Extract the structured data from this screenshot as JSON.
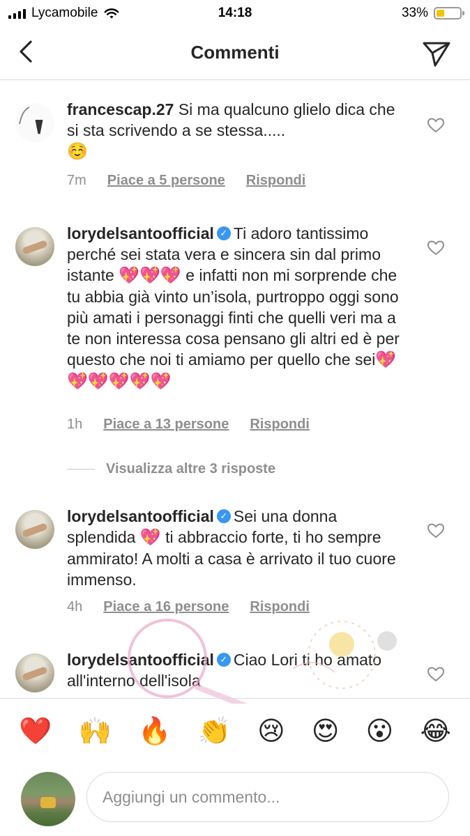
{
  "status_bar": {
    "carrier": "Lycamobile",
    "time": "14:18",
    "battery": "33%",
    "battery_level": 0.33
  },
  "header": {
    "title": "Commenti"
  },
  "comments": [
    {
      "username": "francescap.27",
      "text": "Si ma qualcuno glielo dica che si sta scrivendo a se stessa.....",
      "emoji": "☺️",
      "time": "7m",
      "likes": "Piace a 5 persone",
      "reply": "Rispondi"
    },
    {
      "username": "lorydelsantoofficial",
      "text_part1": "Ti adoro tantissimo perché sei stata vera e sincera sin dal primo istante",
      "emoji1": "💖💖💖",
      "text_part2": "e infatti non mi sorprende che tu abbia già vinto un’isola, purtroppo oggi sono più amati i personaggi finti che quelli veri ma a te non interessa cosa pensano gli altri ed è per questo che noi ti amiamo per quello che sei",
      "emoji2": "💖💖💖💖💖💖",
      "time": "1h",
      "likes": "Piace a 13 persone",
      "reply": "Rispondi"
    },
    {
      "username": "lorydelsantoofficial",
      "text_part1": "Sei una donna splendida",
      "emoji1": "💖",
      "text_part2": "ti abbraccio forte, ti ho sempre ammirato! A molti a casa è arrivato il tuo cuore immenso.",
      "time": "4h",
      "likes": "Piace a 16 persone",
      "reply": "Rispondi"
    },
    {
      "username": "lorydelsantoofficial",
      "text": "Ciao Lori ti ho amato all'interno dell'isola"
    }
  ],
  "more_replies": "Visualizza altre 3 risposte",
  "emoji_bar": [
    "❤️",
    "🙌",
    "🔥",
    "👏",
    "😢",
    "😍",
    "😮",
    "😂"
  ],
  "input": {
    "placeholder": "Aggiungi un commento..."
  },
  "colors": {
    "text": "#262626",
    "secondary": "#8e8e8e",
    "verified": "#3897f0",
    "battery": "#f5c400"
  }
}
